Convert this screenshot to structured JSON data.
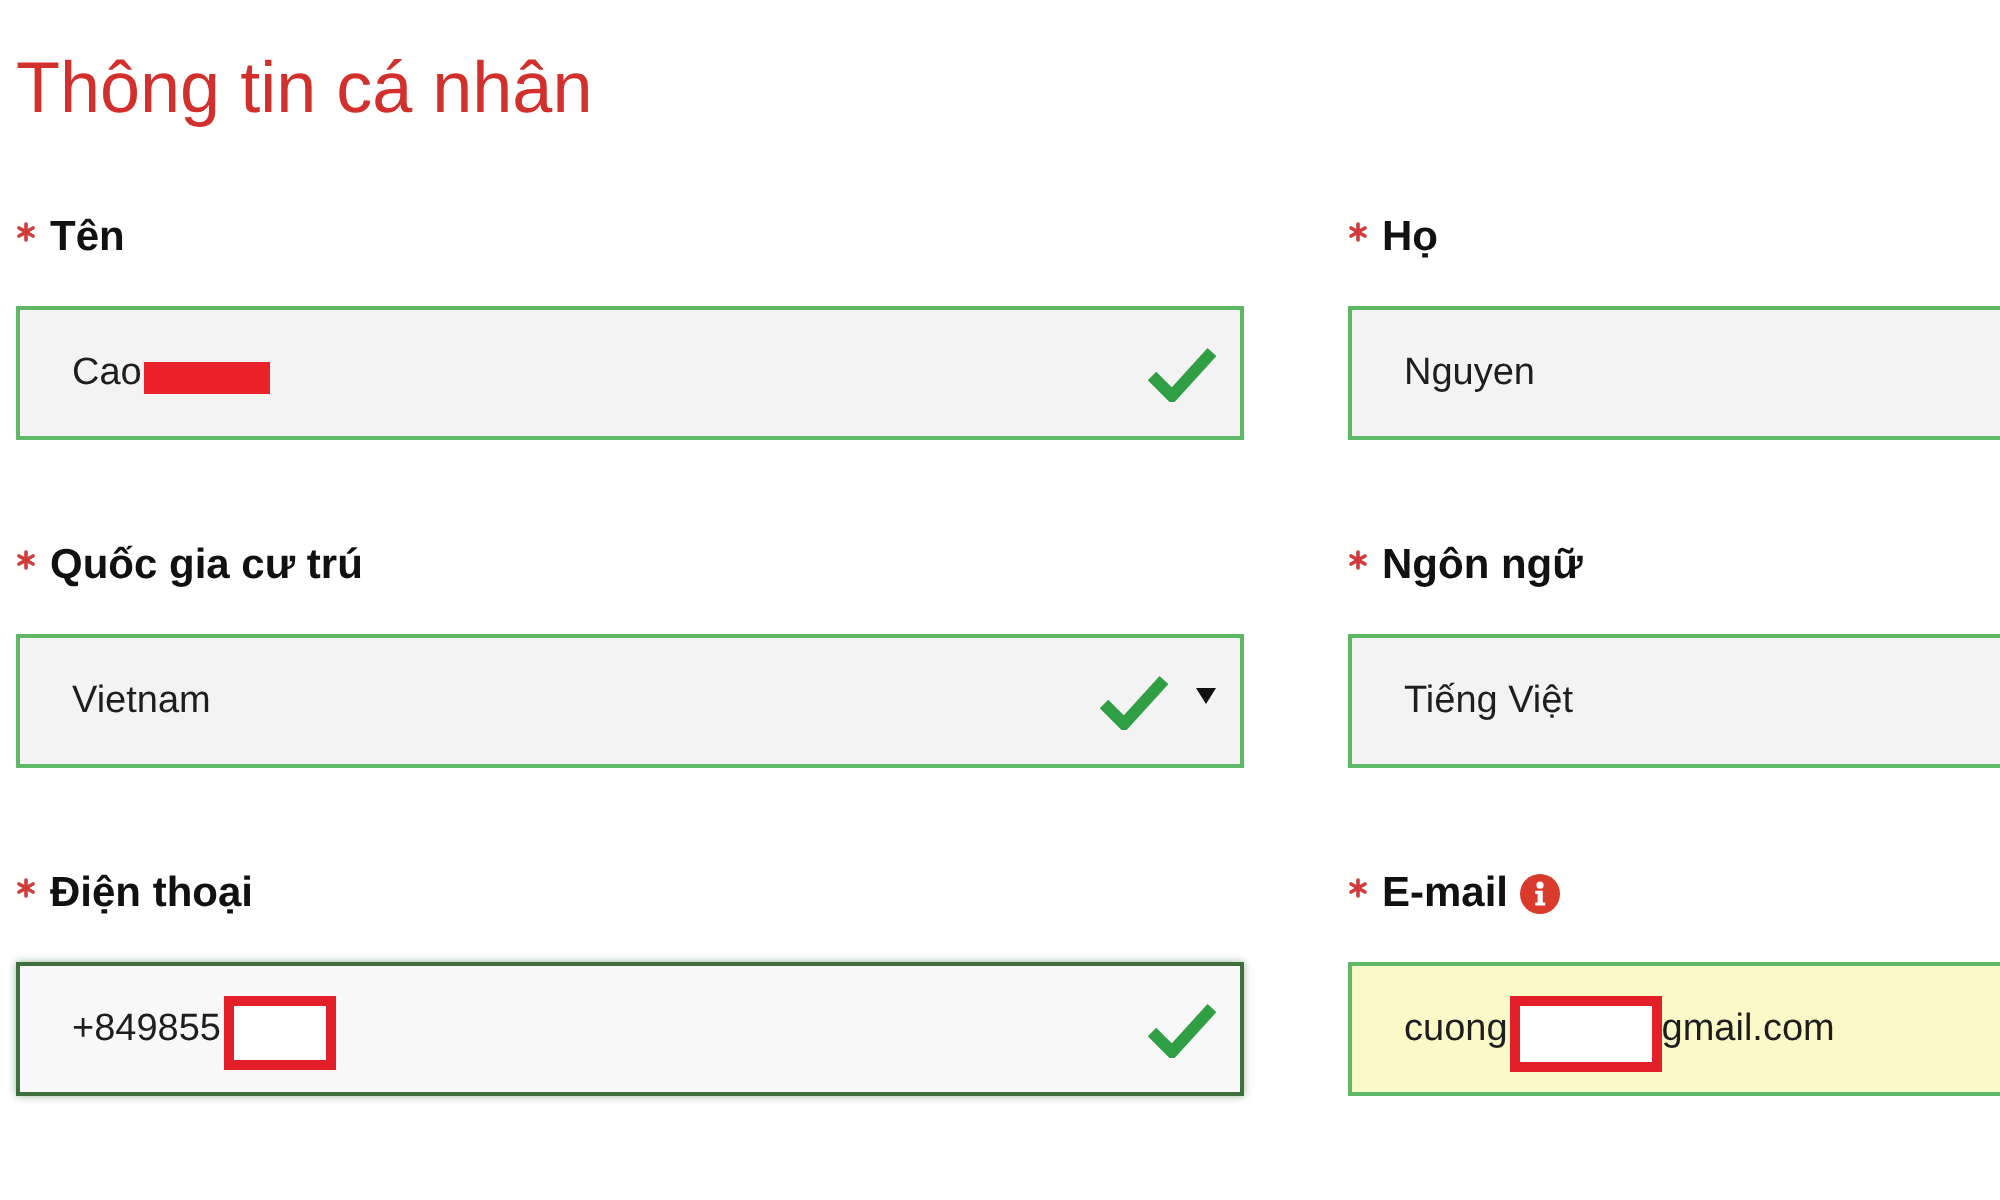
{
  "title": "Thông tin cá nhân",
  "fields": [
    {
      "label": "Tên",
      "required": true,
      "info": false,
      "kind": "text",
      "value": "Cao",
      "redaction": {
        "kind": "filled"
      },
      "valid": true,
      "focused": false,
      "autofilled": false
    },
    {
      "label": "Họ",
      "required": true,
      "info": false,
      "kind": "text",
      "value": "Nguyen",
      "focused": false,
      "autofilled": false
    },
    {
      "label": "Quốc gia cư trú",
      "required": true,
      "info": false,
      "kind": "select",
      "value": "Vietnam",
      "valid": true,
      "focused": false,
      "autofilled": false
    },
    {
      "label": "Ngôn ngữ",
      "required": true,
      "info": false,
      "kind": "text",
      "value": "Tiếng Việt",
      "focused": false,
      "autofilled": false
    },
    {
      "label": "Điện thoại",
      "required": true,
      "info": false,
      "kind": "text",
      "value": "+849855",
      "redaction": {
        "kind": "outlined"
      },
      "valid": true,
      "focused": true,
      "autofilled": false
    },
    {
      "label": "E-mail",
      "required": true,
      "info": true,
      "kind": "text",
      "value": "cuong",
      "redaction": {
        "kind": "outlined"
      },
      "value_after": "gmail.com",
      "focused": false,
      "autofilled": true
    }
  ]
}
